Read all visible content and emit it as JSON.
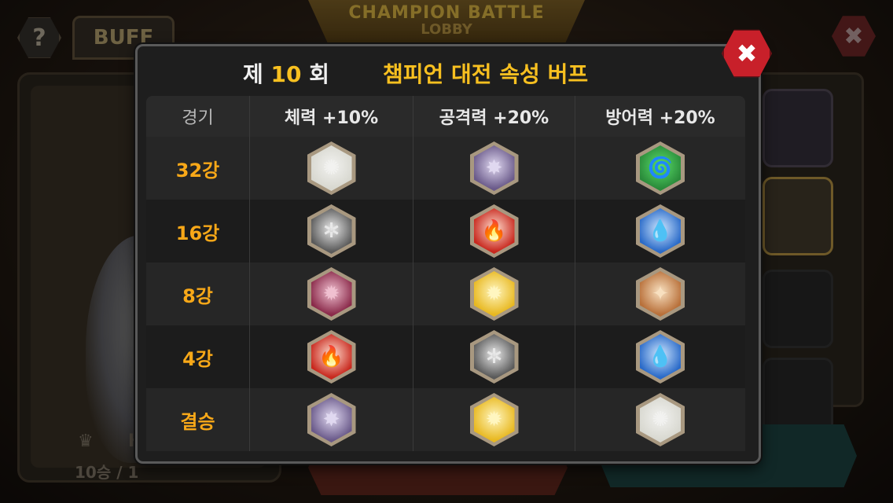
{
  "background": {
    "buff_tab": "BUFF",
    "help_icon": "?",
    "lobby_title": "CHAMPION BATTLE",
    "lobby_sub": "LOBBY",
    "close_glyph": "✖",
    "crown_glyph": "♛",
    "hero_name": "H",
    "record": "10승 / 1"
  },
  "modal": {
    "round_prefix": "제 ",
    "round_number": "10",
    "round_suffix": " 회",
    "title": "챔피언 대전 속성 버프",
    "close_glyph": "✖"
  },
  "table": {
    "headers": [
      "경기",
      "체력 +10%",
      "공격력 +20%",
      "방어력 +20%"
    ],
    "rows": [
      {
        "stage": "32강",
        "icons": [
          "light",
          "dark",
          "wind"
        ]
      },
      {
        "stage": "16강",
        "icons": [
          "metal",
          "fire",
          "water"
        ]
      },
      {
        "stage": "8강",
        "icons": [
          "demon",
          "electric",
          "earth"
        ]
      },
      {
        "stage": "4강",
        "icons": [
          "fire",
          "metal",
          "water"
        ]
      },
      {
        "stage": "결승",
        "icons": [
          "dark",
          "electric",
          "light"
        ]
      }
    ]
  },
  "element_icons": {
    "light": {
      "glyph": "✺",
      "color": "#f2f2f0",
      "bg": "#d8d8d0"
    },
    "dark": {
      "glyph": "✸",
      "color": "#e0d8f0",
      "bg": "#6a5a8a"
    },
    "wind": {
      "glyph": "🌀",
      "color": "#5ae06a",
      "bg": "#2a8a3a"
    },
    "metal": {
      "glyph": "✲",
      "color": "#e8e8e8",
      "bg": "#5a5a5a"
    },
    "fire": {
      "glyph": "🔥",
      "color": "#ffe0d0",
      "bg": "#c8281e"
    },
    "water": {
      "glyph": "💧",
      "color": "#d0e8ff",
      "bg": "#2a6ac8"
    },
    "demon": {
      "glyph": "✹",
      "color": "#f0c0d0",
      "bg": "#8a2a4a"
    },
    "electric": {
      "glyph": "✹",
      "color": "#fff6c0",
      "bg": "#e8b820"
    },
    "earth": {
      "glyph": "✦",
      "color": "#f8e0c0",
      "bg": "#b8703a"
    }
  }
}
